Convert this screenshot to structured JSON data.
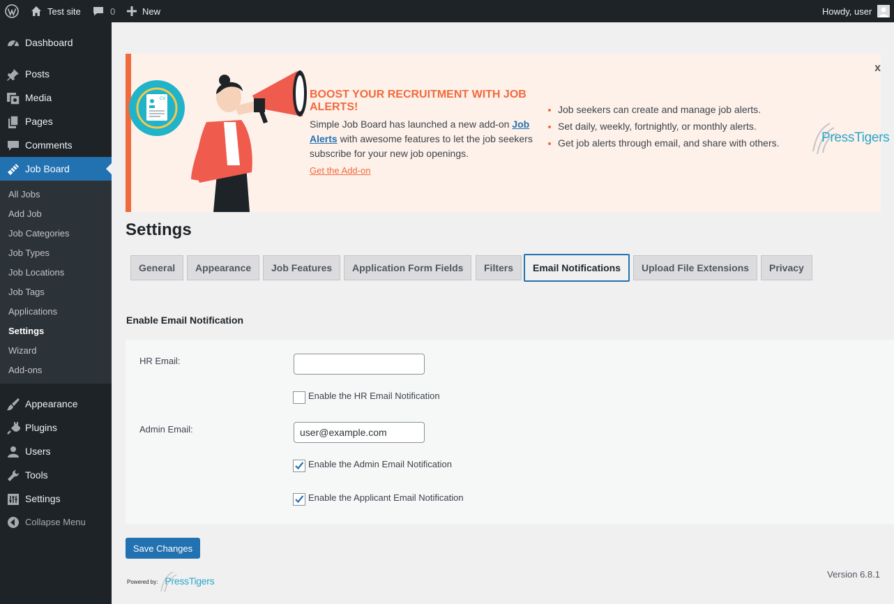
{
  "admin_bar": {
    "site_name": "Test site",
    "comments_count": "0",
    "new_label": "New",
    "greeting": "Howdy, user"
  },
  "sidebar": {
    "items": [
      {
        "label": "Dashboard",
        "icon": "dashboard-icon"
      },
      {
        "label": "Posts",
        "icon": "pin-icon"
      },
      {
        "label": "Media",
        "icon": "media-icon"
      },
      {
        "label": "Pages",
        "icon": "pages-icon"
      },
      {
        "label": "Comments",
        "icon": "comment-icon"
      },
      {
        "label": "Job Board",
        "icon": "job-board-icon"
      },
      {
        "label": "Appearance",
        "icon": "paintbrush-icon"
      },
      {
        "label": "Plugins",
        "icon": "plugin-icon"
      },
      {
        "label": "Users",
        "icon": "users-icon"
      },
      {
        "label": "Tools",
        "icon": "wrench-icon"
      },
      {
        "label": "Settings",
        "icon": "sliders-icon"
      }
    ],
    "submenu": [
      "All Jobs",
      "Add Job",
      "Job Categories",
      "Job Types",
      "Job Locations",
      "Job Tags",
      "Applications",
      "Settings",
      "Wizard",
      "Add-ons"
    ],
    "active_submenu": "Settings",
    "collapse_label": "Collapse Menu"
  },
  "banner": {
    "title": "BOOST YOUR RECRUITMENT WITH JOB ALERTS!",
    "text_before": "Simple Job Board has launched a new add-on ",
    "text_link": "Job Alerts",
    "text_after": " with awesome features to let the job seekers subscribe for your new job openings.",
    "cta": "Get the Add-on",
    "features": [
      "Job seekers can create and manage job alerts.",
      "Set daily, weekly, fortnightly, or monthly alerts.",
      "Get job alerts through email, and share with others."
    ],
    "close_label": "x",
    "logo_text": "PressTigers"
  },
  "page": {
    "title": "Settings",
    "tabs": [
      "General",
      "Appearance",
      "Job Features",
      "Application Form Fields",
      "Filters",
      "Email Notifications",
      "Upload File Extensions",
      "Privacy"
    ],
    "active_tab": "Email Notifications",
    "section_title": "Enable Email Notification"
  },
  "form": {
    "hr_email_label": "HR Email:",
    "hr_email_value": "",
    "hr_checkbox_label": "Enable the HR Email Notification",
    "hr_checked": false,
    "admin_email_label": "Admin Email:",
    "admin_email_value": "user@example.com",
    "admin_checkbox_label": "Enable the Admin Email Notification",
    "admin_checked": true,
    "applicant_checkbox_label": "Enable the Applicant Email Notification",
    "applicant_checked": true
  },
  "footer": {
    "save_button": "Save Changes",
    "powered_by": "Powered by:",
    "powered_logo": "PressTigers",
    "version": "Version 6.8.1"
  },
  "colors": {
    "accent": "#2271b1",
    "banner_accent": "#f06a3d",
    "banner_bg": "#fef1ea",
    "sidebar_bg": "#1d2327"
  }
}
